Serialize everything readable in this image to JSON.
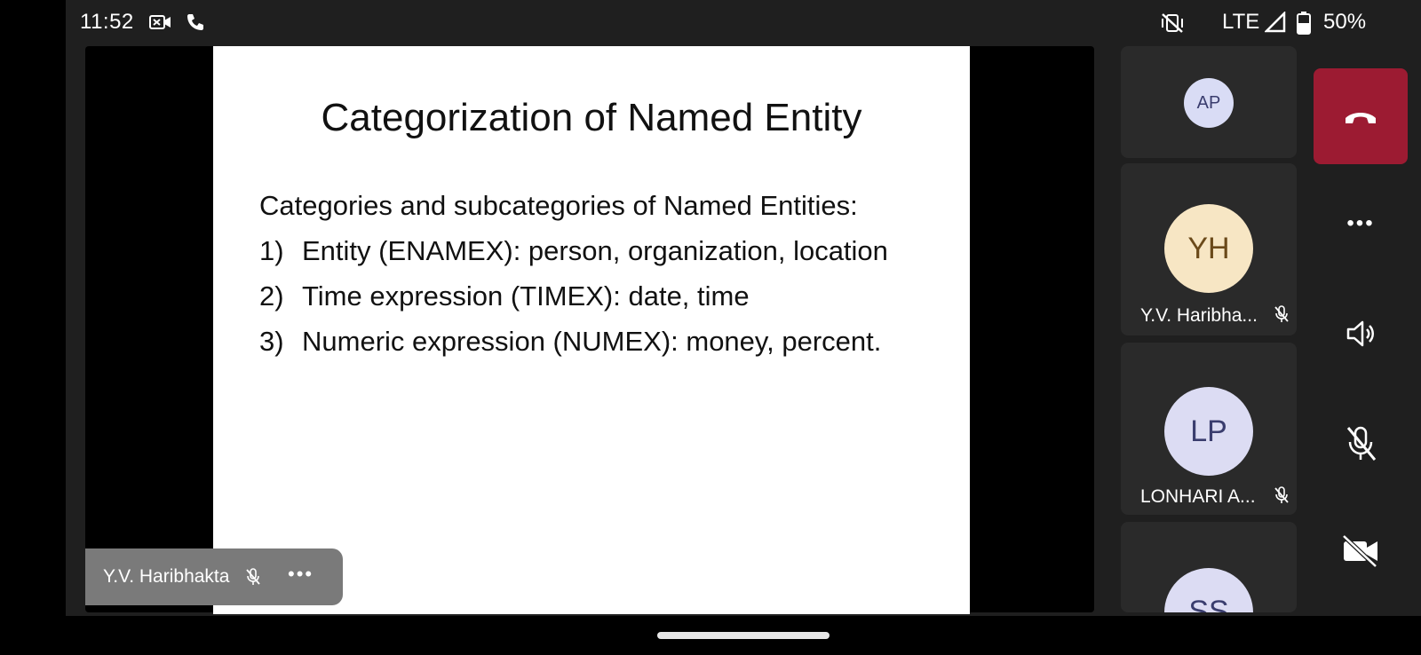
{
  "status_bar": {
    "time": "11:52",
    "network": "LTE",
    "battery": "50%",
    "icons": [
      "video-call-icon",
      "phone-icon",
      "vibrate-off-icon",
      "signal-icon",
      "battery-icon"
    ]
  },
  "slide": {
    "title": "Categorization of Named Entity",
    "intro": "Categories and subcategories of Named Entities:",
    "items": [
      {
        "num": "1)",
        "text": "Entity (ENAMEX): person, organization, location"
      },
      {
        "num": "2)",
        "text": "Time expression (TIMEX): date, time"
      },
      {
        "num": "3)",
        "text": "Numeric expression (NUMEX): money, percent."
      }
    ]
  },
  "presenter_chip": {
    "name": "Y.V. Haribhakta",
    "more": "•••"
  },
  "participants": [
    {
      "initials": "AP",
      "name": "",
      "avatar_bg": "#d9dcf5",
      "avatar_fg": "#3a3d6e"
    },
    {
      "initials": "YH",
      "name": "Y.V. Haribha...",
      "avatar_bg": "#f7e6c4",
      "avatar_fg": "#6b4a1a"
    },
    {
      "initials": "LP",
      "name": "LONHARI A...",
      "avatar_bg": "#dcdcf3",
      "avatar_fg": "#3a3d6e"
    },
    {
      "initials": "SS",
      "name": "",
      "avatar_bg": "#dcdcf3",
      "avatar_fg": "#3a3d6e"
    }
  ],
  "controls": {
    "end_call_color": "#9c1b32",
    "more": "•••"
  }
}
